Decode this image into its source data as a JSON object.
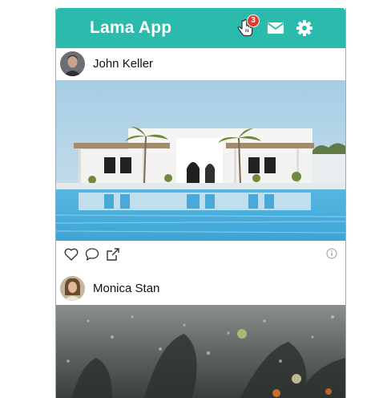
{
  "app": {
    "title": "Lama App",
    "notifications": {
      "count": "3"
    }
  },
  "colors": {
    "navbar": "#2bbbad",
    "badge": "#e23b2e"
  },
  "posts": [
    {
      "username": "John Keller",
      "image": "white villa with arches and pool"
    },
    {
      "username": "Monica Stan",
      "image": "rainy window with blurry lights"
    }
  ],
  "icons": {
    "notification": "hand-pointer-icon",
    "messages": "envelope-icon",
    "settings": "gear-icon",
    "like": "heart-icon",
    "comment": "speech-bubble-icon",
    "share": "share-icon",
    "info": "info-icon"
  }
}
